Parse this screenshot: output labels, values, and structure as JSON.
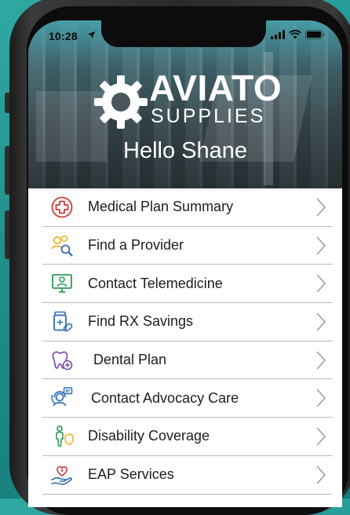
{
  "status_bar": {
    "time": "10:28"
  },
  "brand": {
    "name_line1": "AVIATO",
    "name_line2": "SUPPLIES"
  },
  "greeting": "Hello Shane",
  "menu": {
    "items": [
      {
        "label": "Medical Plan Summary",
        "icon": "medical-cross-icon"
      },
      {
        "label": "Find a Provider",
        "icon": "providers-search-icon"
      },
      {
        "label": "Contact Telemedicine",
        "icon": "telemedicine-monitor-icon"
      },
      {
        "label": "Find RX Savings",
        "icon": "pill-bottle-icon"
      },
      {
        "label": "Dental Plan",
        "icon": "tooth-icon"
      },
      {
        "label": "Contact Advocacy Care",
        "icon": "advocate-headset-icon"
      },
      {
        "label": "Disability Coverage",
        "icon": "person-shield-icon"
      },
      {
        "label": "EAP Services",
        "icon": "heart-hand-icon"
      }
    ]
  },
  "colors": {
    "background": "#1f8d8a",
    "icon_red": "#d23a3a",
    "icon_yellow": "#e8b82a",
    "icon_green": "#2e9b5a",
    "icon_blue": "#2f6fb5",
    "icon_purple": "#7b4aa0",
    "divider": "#b9b9b9"
  }
}
